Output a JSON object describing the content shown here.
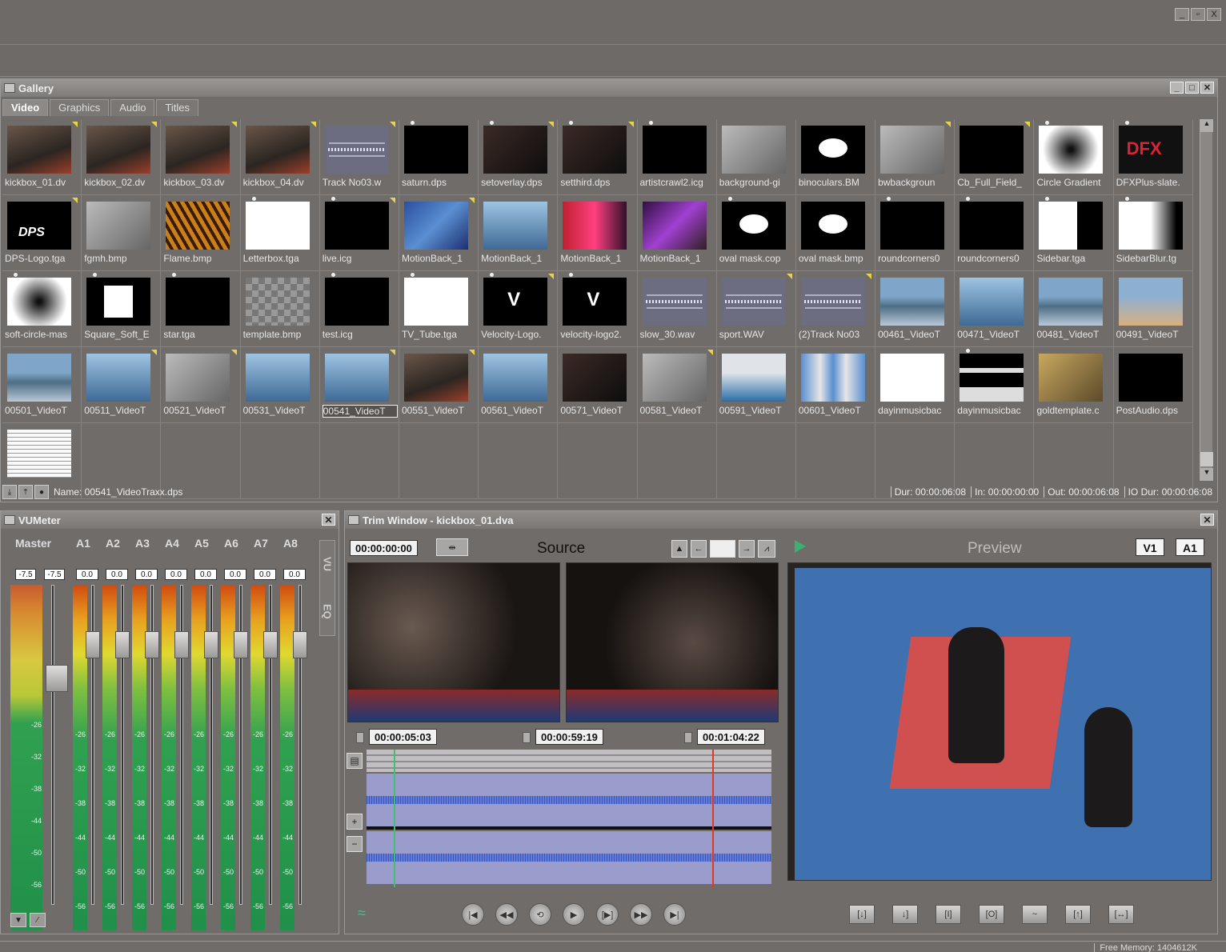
{
  "app": {
    "window_controls": [
      "_",
      "▫",
      "X"
    ]
  },
  "gallery": {
    "title": "Gallery",
    "tabs": [
      "Video",
      "Graphics",
      "Audio",
      "Titles"
    ],
    "active_tab": "Video",
    "items": [
      {
        "label": "kickbox_01.dv",
        "art": "photo",
        "corner": true
      },
      {
        "label": "kickbox_02.dv",
        "art": "photo",
        "corner": true
      },
      {
        "label": "kickbox_03.dv",
        "art": "photo",
        "corner": true
      },
      {
        "label": "kickbox_04.dv",
        "art": "photo",
        "corner": true
      },
      {
        "label": "Track No03.w",
        "art": "wave",
        "corner": true
      },
      {
        "label": "saturn.dps",
        "art": "black",
        "dot": true
      },
      {
        "label": "setoverlay.dps",
        "art": "dark",
        "dot": true,
        "corner": true
      },
      {
        "label": "setthird.dps",
        "art": "dark",
        "dot": true,
        "corner": true
      },
      {
        "label": "artistcrawl2.icg",
        "art": "black",
        "dot": true
      },
      {
        "label": "background-gi",
        "art": "grey"
      },
      {
        "label": "binoculars.BM",
        "art": "blob"
      },
      {
        "label": "bwbackgroun",
        "art": "grey",
        "corner": true
      },
      {
        "label": "Cb_Full_Field_",
        "art": "black",
        "corner": true
      },
      {
        "label": "Circle Gradient",
        "art": "radial",
        "dot": true
      },
      {
        "label": "DFXPlus-slate.",
        "art": "dfx",
        "dot": true
      },
      {
        "label": "DPS-Logo.tga",
        "art": "dps",
        "corner": true
      },
      {
        "label": "fgmh.bmp",
        "art": "grey"
      },
      {
        "label": "Flame.bmp",
        "art": "flame"
      },
      {
        "label": "Letterbox.tga",
        "art": "white",
        "dot": true
      },
      {
        "label": "live.icg",
        "art": "black",
        "dot": true,
        "corner": true
      },
      {
        "label": "MotionBack_1",
        "art": "blue",
        "corner": true
      },
      {
        "label": "MotionBack_1",
        "art": "sky"
      },
      {
        "label": "MotionBack_1",
        "art": "red"
      },
      {
        "label": "MotionBack_1",
        "art": "purple"
      },
      {
        "label": "oval mask.cop",
        "art": "blob",
        "dot": true
      },
      {
        "label": "oval mask.bmp",
        "art": "blob"
      },
      {
        "label": "roundcorners0",
        "art": "black",
        "dot": true
      },
      {
        "label": "roundcorners0",
        "art": "black",
        "dot": true
      },
      {
        "label": "Sidebar.tga",
        "art": "side",
        "dot": true
      },
      {
        "label": "SidebarBlur.tg",
        "art": "sideb",
        "dot": true
      },
      {
        "label": "soft-circle-mas",
        "art": "radial",
        "dot": true
      },
      {
        "label": "Square_Soft_E",
        "art": "sq",
        "dot": true
      },
      {
        "label": "star.tga",
        "art": "black",
        "dot": true
      },
      {
        "label": "template.bmp",
        "art": "pattern"
      },
      {
        "label": "test.icg",
        "art": "black",
        "dot": true
      },
      {
        "label": "TV_Tube.tga",
        "art": "white",
        "dot": true
      },
      {
        "label": "Velocity-Logo.",
        "art": "vel",
        "dot": true,
        "corner": true
      },
      {
        "label": "velocity-logo2.",
        "art": "vel",
        "dot": true
      },
      {
        "label": "slow_30.wav",
        "art": "wave"
      },
      {
        "label": "sport.WAV",
        "art": "wave",
        "corner": true
      },
      {
        "label": "(2)Track No03",
        "art": "wave",
        "corner": true
      },
      {
        "label": "00461_VideoT",
        "art": "sea"
      },
      {
        "label": "00471_VideoT",
        "art": "sky"
      },
      {
        "label": "00481_VideoT",
        "art": "sea"
      },
      {
        "label": "00491_VideoT",
        "art": "sand"
      },
      {
        "label": "00501_VideoT",
        "art": "sea"
      },
      {
        "label": "00511_VideoT",
        "art": "sky",
        "corner": true
      },
      {
        "label": "00521_VideoT",
        "art": "grey",
        "corner": true
      },
      {
        "label": "00531_VideoT",
        "art": "sky"
      },
      {
        "label": "00541_VideoT",
        "art": "sky",
        "selected": true,
        "corner": true
      },
      {
        "label": "00551_VideoT",
        "art": "photo",
        "corner": true
      },
      {
        "label": "00561_VideoT",
        "art": "sky"
      },
      {
        "label": "00571_VideoT",
        "art": "dark"
      },
      {
        "label": "00581_VideoT",
        "art": "grey",
        "corner": true
      },
      {
        "label": "00591_VideoT",
        "art": "wave2"
      },
      {
        "label": "00601_VideoT",
        "art": "bldg"
      },
      {
        "label": "dayinmusicbac",
        "art": "white"
      },
      {
        "label": "dayinmusicbac",
        "art": "bars",
        "dot": true
      },
      {
        "label": "goldtemplate.c",
        "art": "gold"
      },
      {
        "label": "PostAudio.dps",
        "art": "black"
      },
      {
        "label": "",
        "art": "doc"
      }
    ],
    "status": {
      "name": "Name: 00541_VideoTraxx.dps",
      "dur": "Dur: 00:00:06:08",
      "in": "In: 00:00:00:00",
      "out": "Out: 00:00:06:08",
      "io_dur": "IO Dur: 00:00:06:08"
    }
  },
  "vumeter": {
    "title": "VUMeter",
    "master_label": "Master",
    "master_values": [
      "-7.5",
      "-7.5"
    ],
    "channels": [
      "A1",
      "A2",
      "A3",
      "A4",
      "A5",
      "A6",
      "A7",
      "A8"
    ],
    "channel_values": [
      "0.0",
      "0.0",
      "0.0",
      "0.0",
      "0.0",
      "0.0",
      "0.0",
      "0.0"
    ],
    "scale": [
      "-26",
      "-32",
      "-38",
      "-44",
      "-50",
      "-56"
    ],
    "side_tabs": [
      "VU",
      "EQ"
    ]
  },
  "trim": {
    "title": "Trim Window - kickbox_01.dva",
    "source_tc": "00:00:00:00",
    "source_label": "Source",
    "preview_label": "Preview",
    "v1": "V1",
    "a1": "A1",
    "in_tc": "00:00:05:03",
    "mid_tc": "00:00:59:19",
    "out_tc": "00:01:04:22"
  },
  "footer": {
    "memory": "Free Memory: 1404612K"
  }
}
